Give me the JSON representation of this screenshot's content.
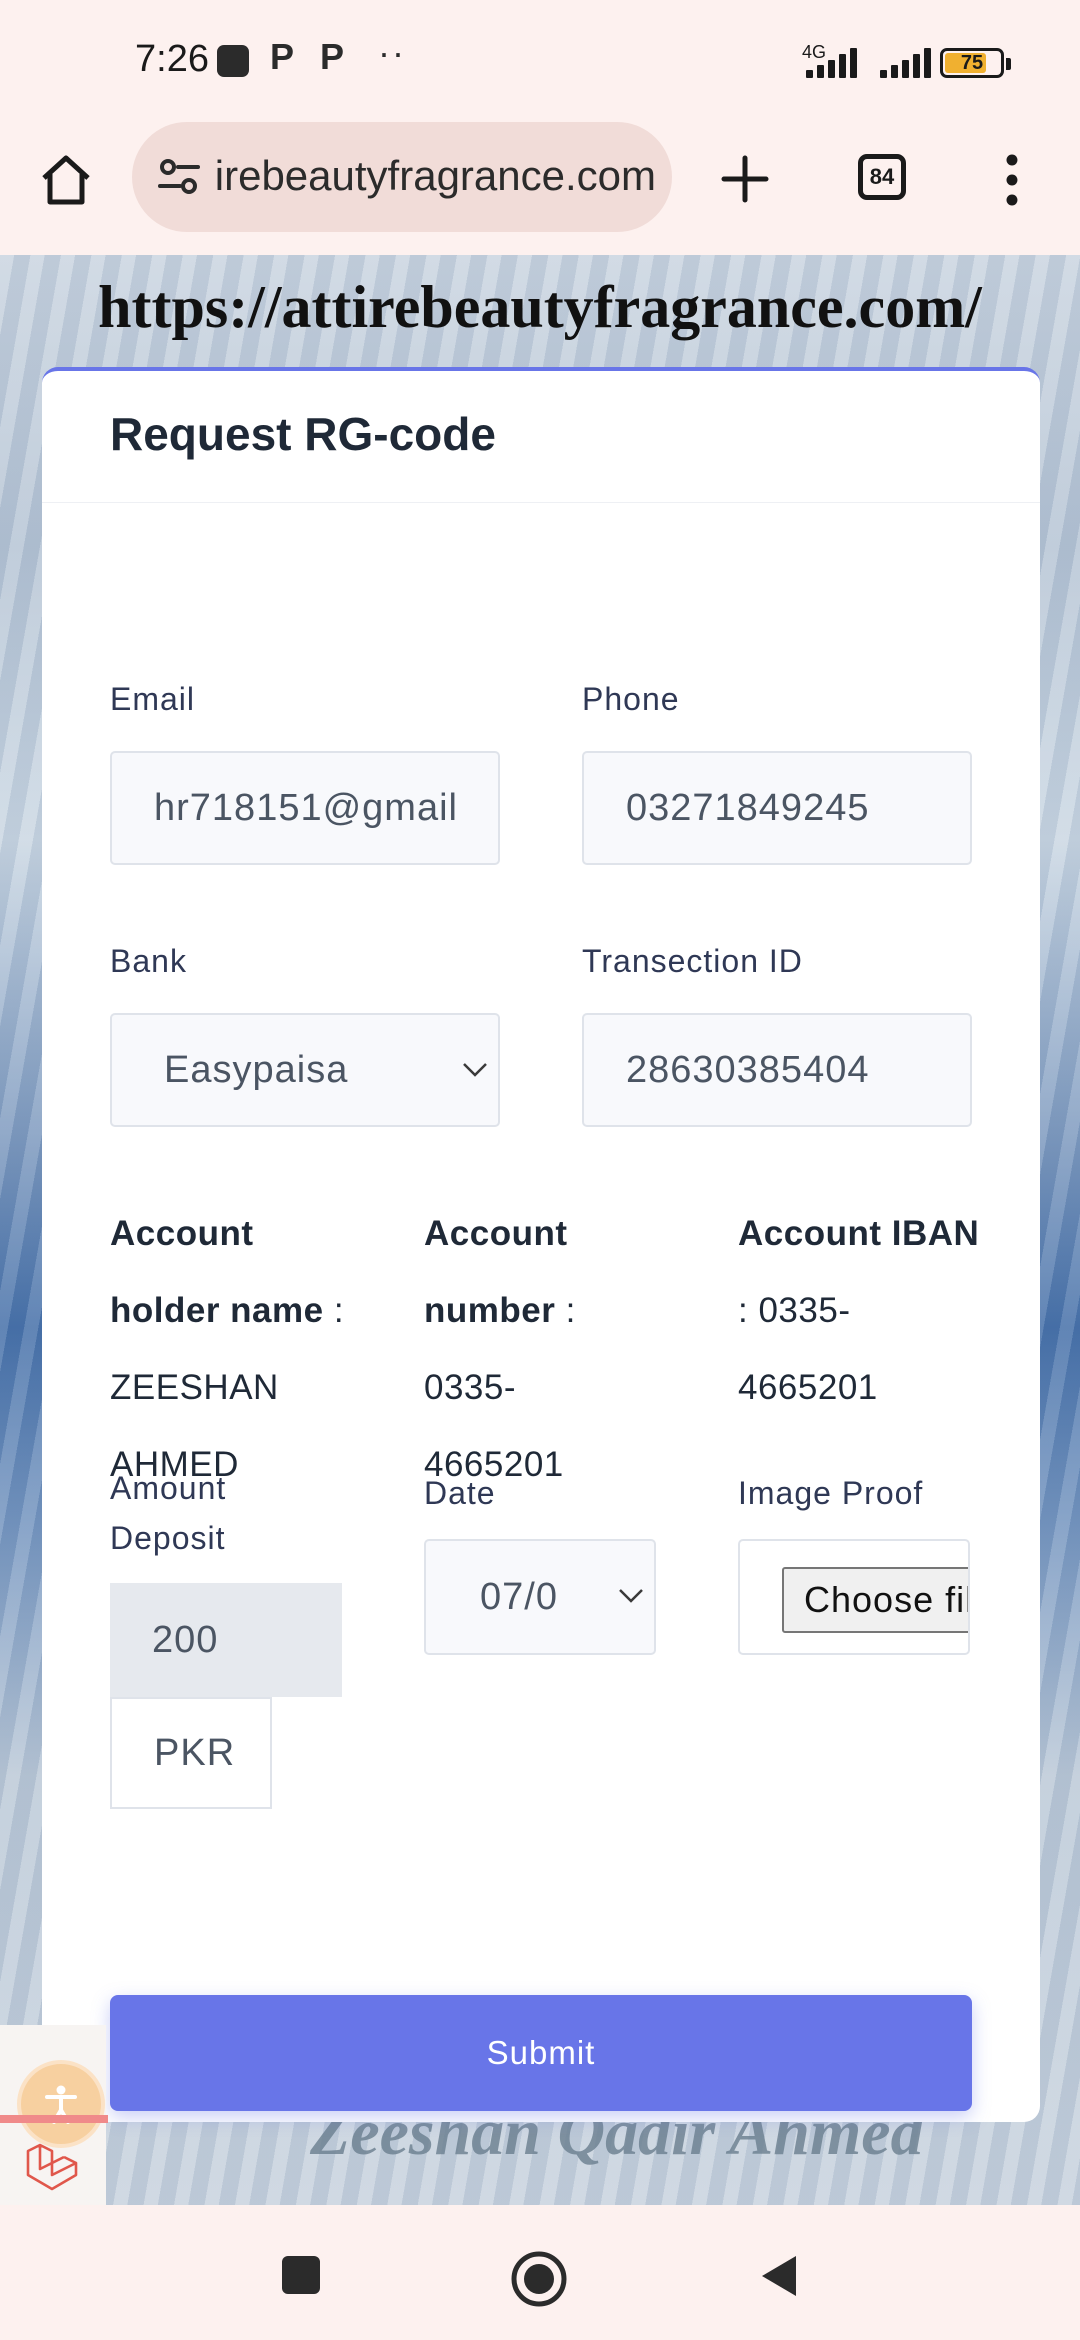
{
  "status_bar": {
    "time": "7:26",
    "notif_p1": "P",
    "notif_p2": "P",
    "more_dots": "··",
    "network": "4G",
    "battery": "75"
  },
  "browser": {
    "url": "attirebeautyfragrance.com",
    "tab_count": "84"
  },
  "page": {
    "banner_url": "https://attirebeautyfragrance.com/",
    "background_signature": "Zeeshan Qadir Ahmed"
  },
  "form": {
    "title": "Request RG-code",
    "email": {
      "label": "Email",
      "value": "hr718151@gmail"
    },
    "phone": {
      "label": "Phone",
      "value": "03271849245"
    },
    "bank": {
      "label": "Bank",
      "value": "Easypaisa"
    },
    "transaction": {
      "label": "Transection ID",
      "value": "28630385404"
    },
    "account_holder": {
      "label": "Account holder name",
      "value": ": ZEESHAN AHMED"
    },
    "account_number": {
      "label": "Account number",
      "value": "0335-4665201"
    },
    "account_iban": {
      "label": "Account IBAN",
      "value": "0335-4665201"
    },
    "amount": {
      "label": "Amount Deposit",
      "value": "200",
      "currency": "PKR"
    },
    "date": {
      "label": "Date",
      "value": "07/0"
    },
    "image_proof": {
      "label": "Image Proof",
      "button": "Choose file"
    },
    "submit_label": "Submit"
  }
}
